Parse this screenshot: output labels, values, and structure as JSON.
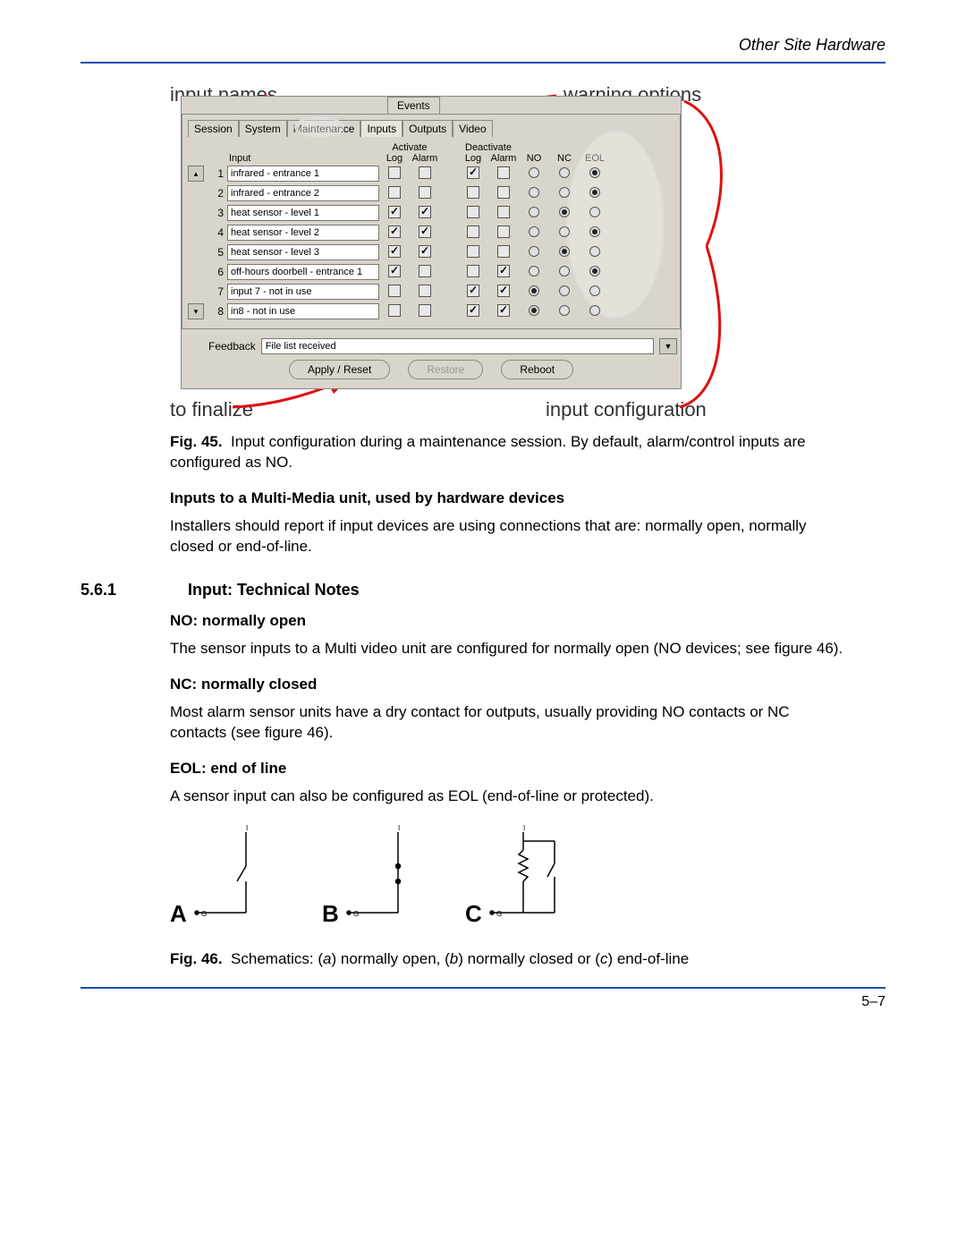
{
  "header": {
    "title": "Other Site Hardware"
  },
  "footer": {
    "page": "5–7"
  },
  "annotations": {
    "input_names": "input names",
    "warning_options": "warning options",
    "to_finalize": "to finalize",
    "input_configuration": "input configuration"
  },
  "dialog": {
    "top_tab": "Events",
    "tabs": [
      "Session",
      "System",
      "Maintenance",
      "Inputs",
      "Outputs",
      "Video"
    ],
    "active_tab_index": 3,
    "columns": {
      "input": "Input",
      "activate": "Activate",
      "deactivate": "Deactivate",
      "log": "Log",
      "alarm": "Alarm",
      "no": "NO",
      "nc": "NC",
      "eol": "EOL"
    },
    "rows": [
      {
        "n": 1,
        "name": "infrared - entrance 1",
        "aLog": false,
        "aAlarm": false,
        "dLog": true,
        "dAlarm": false,
        "mode": "EOL"
      },
      {
        "n": 2,
        "name": "infrared - entrance 2",
        "aLog": false,
        "aAlarm": false,
        "dLog": false,
        "dAlarm": false,
        "mode": "EOL"
      },
      {
        "n": 3,
        "name": "heat sensor - level 1",
        "aLog": true,
        "aAlarm": true,
        "dLog": false,
        "dAlarm": false,
        "mode": "NC"
      },
      {
        "n": 4,
        "name": "heat sensor - level 2",
        "aLog": true,
        "aAlarm": true,
        "dLog": false,
        "dAlarm": false,
        "mode": "EOL"
      },
      {
        "n": 5,
        "name": "heat sensor - level 3",
        "aLog": true,
        "aAlarm": true,
        "dLog": false,
        "dAlarm": false,
        "mode": "NC"
      },
      {
        "n": 6,
        "name": "off-hours doorbell - entrance 1",
        "aLog": true,
        "aAlarm": false,
        "dLog": false,
        "dAlarm": true,
        "mode": "EOL"
      },
      {
        "n": 7,
        "name": "input 7 - not in use",
        "aLog": false,
        "aAlarm": false,
        "dLog": true,
        "dAlarm": true,
        "mode": "NO"
      },
      {
        "n": 8,
        "name": "in8 - not in use",
        "aLog": false,
        "aAlarm": false,
        "dLog": true,
        "dAlarm": true,
        "mode": "NO"
      }
    ],
    "feedback_label": "Feedback",
    "feedback_value": "File list received",
    "buttons": {
      "apply": "Apply / Reset",
      "restore": "Restore",
      "reboot": "Reboot"
    }
  },
  "fig45": {
    "label": "Fig. 45.",
    "text": "Input configuration during a maintenance session. By default, alarm/control inputs are configured as NO."
  },
  "inputs_heading": "Inputs to a Multi-Media unit, used by hardware devices",
  "inputs_para": "Installers should report if input devices are using connections that are: normally open, normally closed or end-of-line.",
  "section": {
    "num": "5.6.1",
    "title": "Input: Technical Notes"
  },
  "no_head": "NO: normally open",
  "no_para": "The sensor inputs to a Multi video unit are configured for normally open (NO devices; see figure 46).",
  "nc_head": "NC: normally closed",
  "nc_para": "Most alarm sensor units have a dry contact for outputs, usually providing NO contacts or NC contacts (see figure 46).",
  "eol_head": "EOL: end of line",
  "eol_para": "A sensor input can also be configured as EOL (end-of-line or protected).",
  "fig46": {
    "label": "Fig. 46.",
    "text": "Schematics: (a) normally open, (b) normally closed or (c) end-of-line",
    "labels": {
      "a": "A",
      "b": "B",
      "c": "C"
    },
    "terminals": {
      "in": "I",
      "gnd": "G"
    }
  }
}
